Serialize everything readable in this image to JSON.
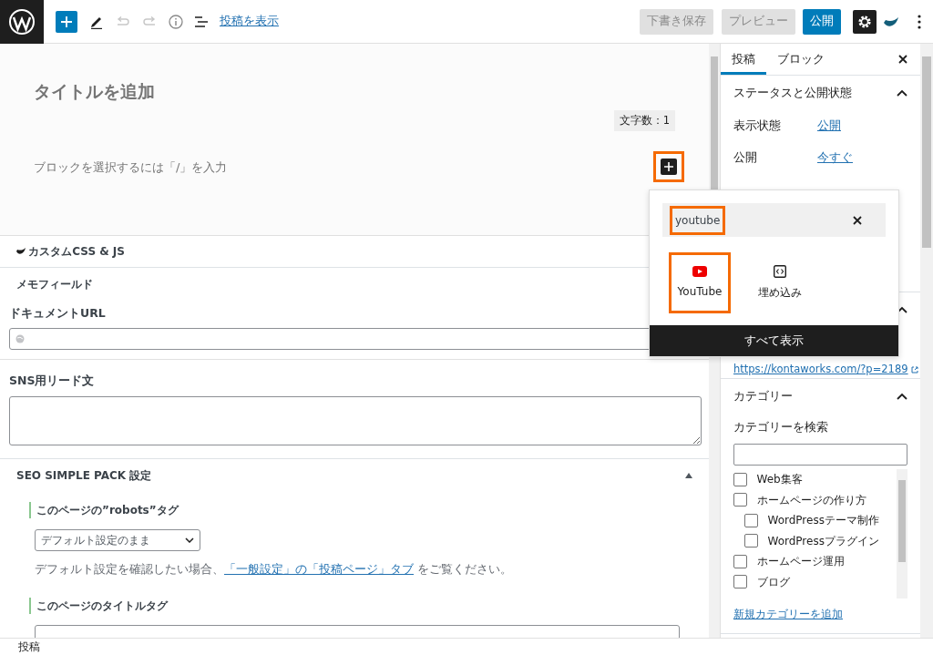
{
  "toolbar": {
    "view_post_link": "投稿を表示",
    "undo_disabled": true,
    "redo_disabled": true,
    "buttons": [
      {
        "label": "下書き保存",
        "kind": "secondary"
      },
      {
        "label": "プレビュー",
        "kind": "secondary"
      },
      {
        "label": "公開",
        "kind": "primary"
      }
    ],
    "settings_active": true
  },
  "editor": {
    "title_placeholder": "タイトルを追加",
    "word_count": "文字数：1",
    "block_placeholder": "ブロックを選択するには「/」を入力",
    "inserter_highlighted": true
  },
  "meta_boxes": [
    {
      "kind": "plugin",
      "title": "カスタムCSS & JS"
    },
    {
      "kind": "memo",
      "title": "メモフィールド",
      "fields": [
        {
          "label": "ドキュメントURL",
          "kind": "url"
        },
        {
          "label": "SNS用リード文",
          "kind": "textarea"
        }
      ]
    },
    {
      "kind": "seo",
      "title": "SEO SIMPLE PACK 設定",
      "expanded": true,
      "settings": [
        {
          "label": "このページの”robots”タグ",
          "kind": "select",
          "value": "デフォルト設定のまま",
          "help": "デフォルト設定を確認したい場合、",
          "help_link": "「一般設定」の「投稿ページ」タブ",
          "help_after": " をご覧ください。"
        },
        {
          "label": "このページのタイトルタグ",
          "kind": "input"
        }
      ]
    }
  ],
  "sidebar": {
    "tabs": [
      {
        "label": "投稿",
        "selected": true
      },
      {
        "label": "ブロック",
        "selected": false
      }
    ],
    "panels": [
      {
        "kind": "status",
        "title": "ステータスと公開状態",
        "expanded": true,
        "rows": [
          {
            "label": "表示状態",
            "value": "公開"
          },
          {
            "label": "公開",
            "value": "今すぐ"
          }
        ]
      },
      {
        "kind": "permalink",
        "expanded": true,
        "link": "https://kontaworks.com/?p=2189"
      },
      {
        "kind": "categories",
        "title": "カテゴリー",
        "expanded": true,
        "search_label": "カテゴリーを検索",
        "add_link": "新規カテゴリーを追加",
        "items": [
          {
            "label": "Web集客",
            "checked": false
          },
          {
            "label": "ホームページの作り方",
            "checked": false,
            "children": [
              {
                "label": "WordPressテーマ制作",
                "checked": false
              },
              {
                "label": "WordPressプラグイン",
                "checked": false
              }
            ]
          },
          {
            "label": "ホームページ運用",
            "checked": false
          },
          {
            "label": "ブログ",
            "checked": false
          }
        ]
      }
    ]
  },
  "inserter_popover": {
    "search_value": "youtube",
    "search_highlighted": true,
    "results": [
      {
        "label": "YouTube",
        "kind": "youtube",
        "highlighted": true
      },
      {
        "label": "埋め込み",
        "kind": "embed",
        "highlighted": false
      }
    ],
    "show_all": "すべて表示"
  },
  "status_bar": "投稿"
}
